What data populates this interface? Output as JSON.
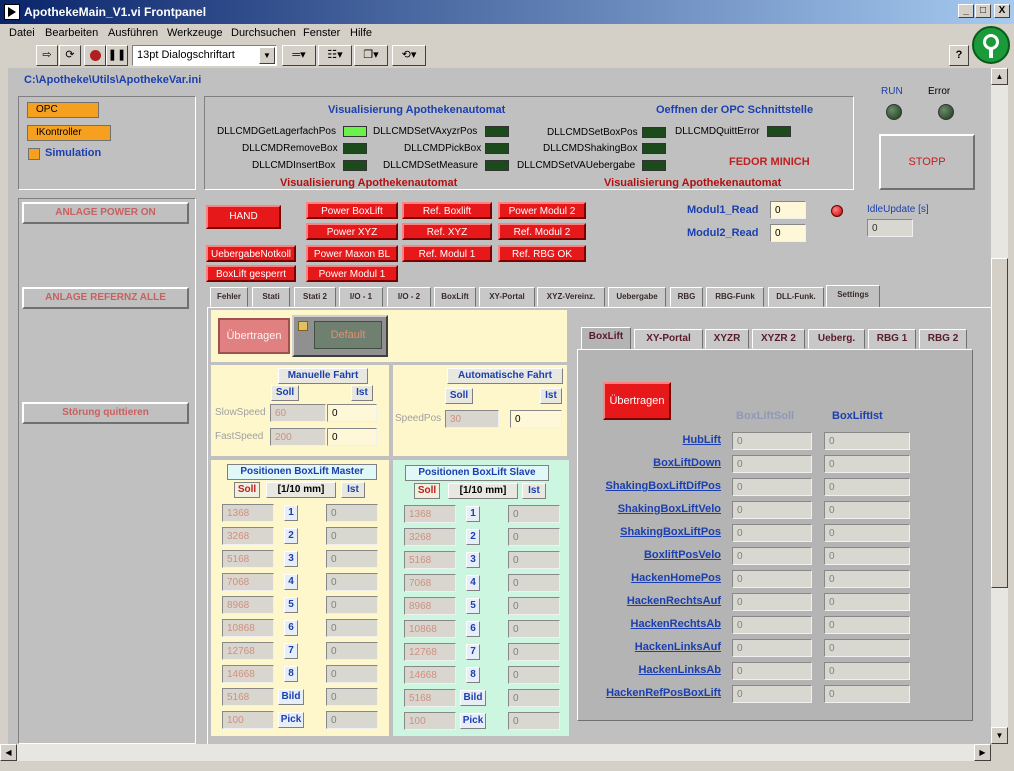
{
  "window": {
    "title": "ApothekeMain_V1.vi Frontpanel",
    "min": "_",
    "max": "□",
    "close": "X"
  },
  "menu": [
    "Datei",
    "Bearbeiten",
    "Ausführen",
    "Werkzeuge",
    "Durchsuchen",
    "Fenster",
    "Hilfe"
  ],
  "toolbar": {
    "font": "13pt Dialogschriftart",
    "help": "?"
  },
  "path": "C:\\Apotheke\\Utils\\ApothekeVar.ini",
  "rings": {
    "opc": "OPC",
    "kontroller": "IKontroller"
  },
  "simulation_label": "Simulation",
  "status": {
    "run": "RUN",
    "error": "Error",
    "stop": "STOPP"
  },
  "vis": {
    "title1": "Visualisierung Apothekenautomat",
    "title2": "Oeffnen der OPC Schnittstelle",
    "foot1": "Visualisierung Apothekenautomat",
    "foot2": "Visualisierung Apothekenautomat",
    "author": "FEDOR MINICH",
    "cmd": [
      "DLLCMDGetLagerfachPos",
      "DLLCMDSetVAxyzrPos",
      "DLLCMDSetBoxPos",
      "DLLCMDQuittError",
      "DLLCMDRemoveBox",
      "DLLCMDPickBox",
      "DLLCMDShakingBox",
      "DLLCMDInsertBox",
      "DLLCMDSetMeasure",
      "DLLCMDSetVAUebergabe"
    ]
  },
  "left_buttons": {
    "power_on": "ANLAGE  POWER ON",
    "referenz": "ANLAGE REFERNZ ALLE",
    "quit": "Störung quittieren"
  },
  "red_buttons": [
    "HAND",
    "UebergabeNotkoll",
    "BoxLift gesperrt",
    "Power BoxLift",
    "Power XYZ",
    "Power Maxon BL",
    "Power Modul 1",
    "Ref. Boxlift",
    "Ref. XYZ",
    "Ref. Modul 1",
    "Power Modul 2",
    "Ref. Modul 2",
    "Ref. RBG OK"
  ],
  "modul": {
    "read1": "Modul1_Read",
    "read2": "Modul2_Read",
    "val1": "0",
    "val2": "0",
    "idle_label": "IdleUpdate [s]",
    "idle": "0"
  },
  "tabs": [
    "Fehler",
    "Stati",
    "Stati 2",
    "I/O - 1",
    "I/O - 2",
    "BoxLift",
    "XY-Portal",
    "XYZ-Vereinz.",
    "Uebergabe",
    "RBG",
    "RBG-Funk",
    "DLL-Funk.",
    "Settings"
  ],
  "settings": {
    "uebertragen": "Übertragen",
    "default": "Default",
    "manuell": "Manuelle Fahrt",
    "automatisch": "Automatische Fahrt",
    "soll": "Soll",
    "ist": "Ist",
    "slow_label": "SlowSpeed",
    "slow_soll": "60",
    "slow_ist": "0",
    "fast_label": "FastSpeed",
    "fast_soll": "200",
    "fast_ist": "0",
    "speed_label": "SpeedPos",
    "speed_soll": "30",
    "speed_ist": "0",
    "master_title": "Positionen BoxLift Master",
    "slave_title": "Positionen BoxLift Slave",
    "unit": "[1/10 mm]",
    "positions": [
      "1368",
      "3268",
      "5168",
      "7068",
      "8968",
      "10868",
      "12768",
      "14668",
      "5168",
      "100"
    ],
    "pos_labels": [
      "1",
      "2",
      "3",
      "4",
      "5",
      "6",
      "7",
      "8",
      "Bild",
      "Pick"
    ],
    "ist_val": "0"
  },
  "inner_tabs": [
    "BoxLift",
    "XY-Portal",
    "XYZR",
    "XYZR 2",
    "Ueberg.",
    "RBG 1",
    "RBG 2"
  ],
  "boxlift": {
    "uebertragen": "Übertragen",
    "col_soll": "BoxLiftSoll",
    "col_ist": "BoxLiftIst",
    "rows": [
      "HubLift",
      "BoxLiftDown",
      "ShakingBoxLiftDifPos",
      "ShakingBoxLiftVelo",
      "ShakingBoxLiftPos",
      "BoxliftPosVelo",
      "HackenHomePos",
      "HackenRechtsAuf",
      "HackenRechtsAb",
      "HackenLinksAuf",
      "HackenLinksAb",
      "HackenRefPosBoxLift"
    ],
    "val": "0"
  },
  "colors": {
    "accent_red": "#e6181a",
    "label_blue": "#1b3fae",
    "led_on": "#6cf04a",
    "led_off": "#1b4a1b"
  }
}
